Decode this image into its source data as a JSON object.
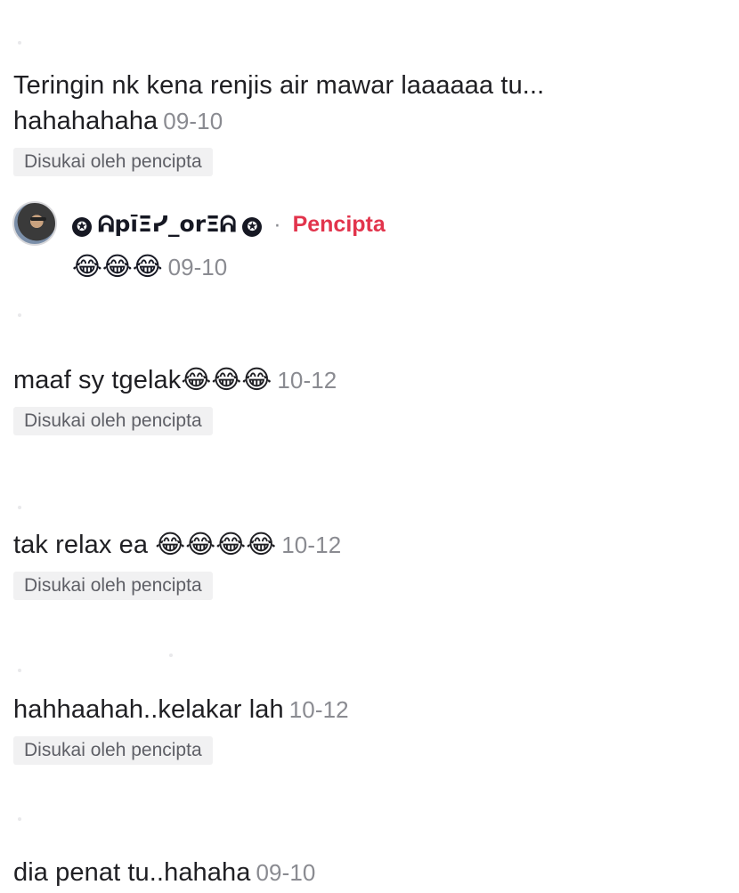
{
  "comments": [
    {
      "text": "Teringin nk kena renjis air mawar laaaaaa tu...",
      "text_line2": "hahahahaha",
      "timestamp": "09-10",
      "liked_label": "Disukai oleh pencipta"
    },
    {
      "text": "maaf sy tgelak",
      "emoji": "😂😂😂",
      "timestamp": "10-12",
      "liked_label": "Disukai oleh pencipta"
    },
    {
      "text": "tak relax ea",
      "emoji": "😂😂😂😂",
      "timestamp": "10-12",
      "liked_label": "Disukai oleh pencipta"
    },
    {
      "text": "hahhaahah..kelakar lah",
      "timestamp": "10-12",
      "liked_label": "Disukai oleh pencipta"
    },
    {
      "text": "dia penat tu..hahaha",
      "timestamp": "09-10"
    }
  ],
  "reply": {
    "username": "ᕱpīΞᓯ_orΞᕱ",
    "star_icon": "✪",
    "separator": "·",
    "creator_label": "Pencipta",
    "emoji": "😂😂😂",
    "timestamp": "09-10"
  }
}
